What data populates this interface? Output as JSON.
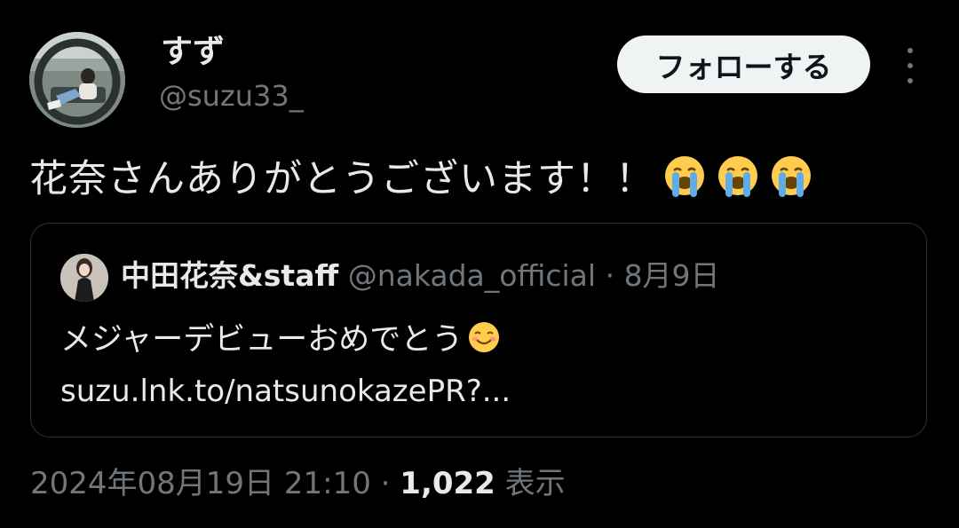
{
  "author": {
    "display_name": "すず",
    "handle": "@suzu33_"
  },
  "actions": {
    "follow_label": "フォローする",
    "more_icon": "more-vertical-icon"
  },
  "tweet": {
    "text": "花奈さんありがとうございます！！",
    "emojis": [
      "loudly-crying-face",
      "loudly-crying-face",
      "loudly-crying-face"
    ]
  },
  "quote": {
    "display_name": "中田花奈&staff",
    "handle": "@nakada_official",
    "separator": "·",
    "date": "8月9日",
    "text": "メジャーデビューおめでとう",
    "emoji": "smiling-face",
    "link": "suzu.lnk.to/natsunokazePR?..."
  },
  "meta": {
    "timestamp": "2024年08月19日 21:10",
    "separator": "·",
    "views_count": "1,022",
    "views_label": "表示"
  },
  "colors": {
    "background": "#000000",
    "text_primary": "#e7e9ea",
    "text_secondary": "#71767b",
    "border": "#2f3336",
    "follow_button_bg": "#eff3f4",
    "follow_button_text": "#0f1419"
  }
}
